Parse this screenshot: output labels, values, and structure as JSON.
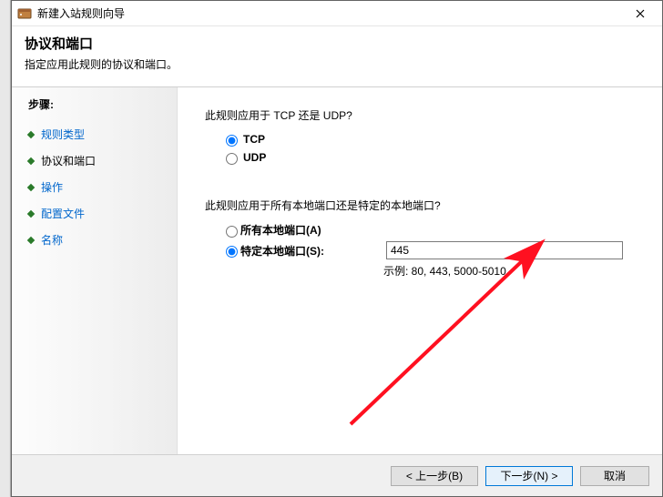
{
  "window": {
    "title": "新建入站规则向导"
  },
  "header": {
    "title": "协议和端口",
    "subtitle": "指定应用此规则的协议和端口。"
  },
  "sidebar": {
    "steps_label": "步骤:",
    "items": [
      {
        "label": "规则类型",
        "state": "link"
      },
      {
        "label": "协议和端口",
        "state": "current"
      },
      {
        "label": "操作",
        "state": "link"
      },
      {
        "label": "配置文件",
        "state": "link"
      },
      {
        "label": "名称",
        "state": "link"
      }
    ]
  },
  "content": {
    "protocol_question": "此规则应用于 TCP 还是 UDP?",
    "tcp_label": "TCP",
    "udp_label": "UDP",
    "protocol_selected": "tcp",
    "port_question": "此规则应用于所有本地端口还是特定的本地端口?",
    "all_ports_label": "所有本地端口(A)",
    "specific_ports_label": "特定本地端口(S):",
    "port_scope_selected": "specific",
    "port_value": "445",
    "port_example": "示例: 80, 443, 5000-5010"
  },
  "footer": {
    "back_full": "< 上一步(B)",
    "next_full": "下一步(N) >",
    "cancel": "取消"
  }
}
